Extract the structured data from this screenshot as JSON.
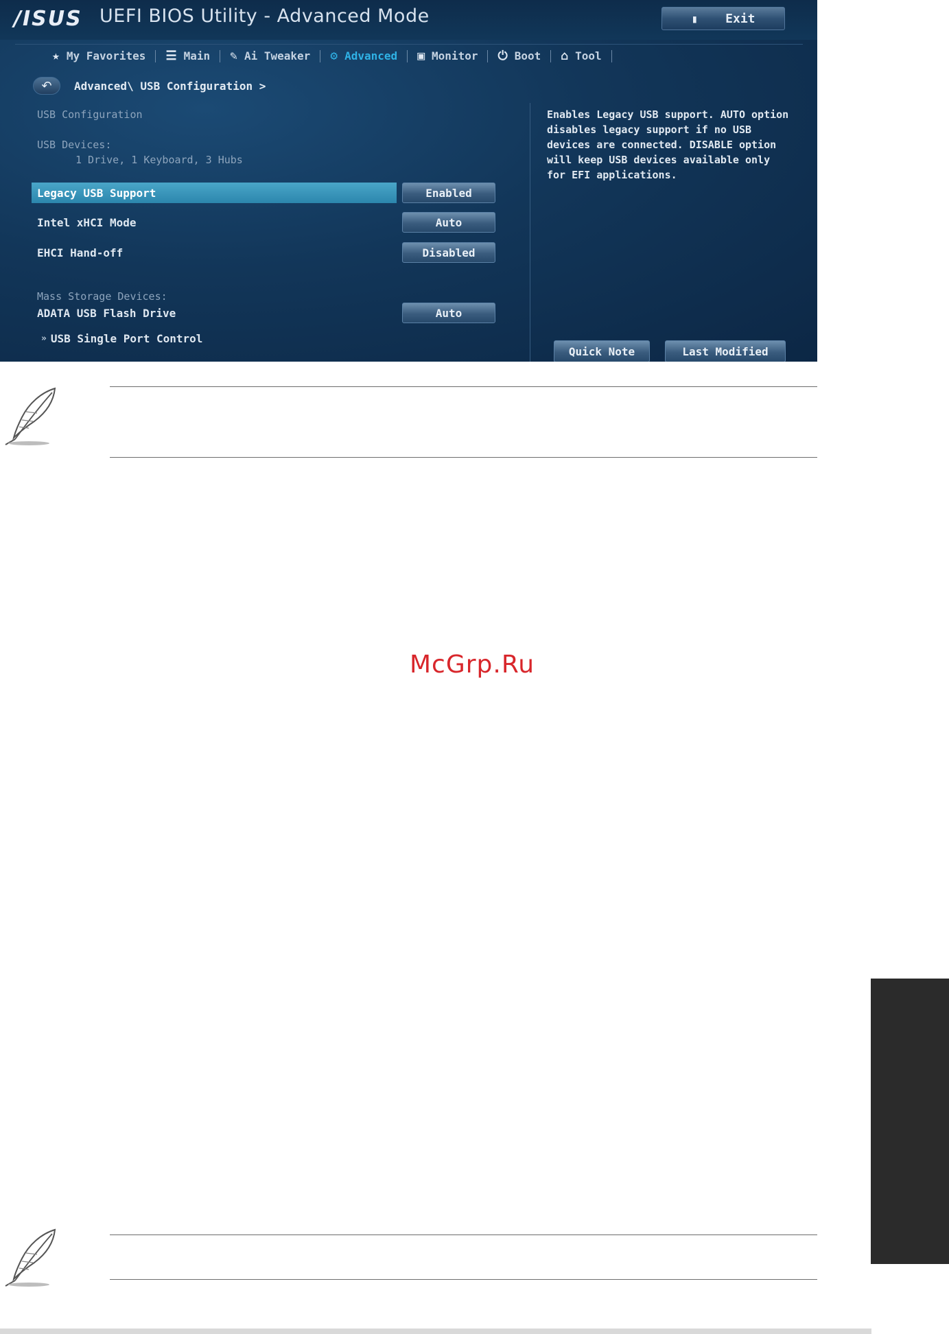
{
  "bios": {
    "logo": "/ISUS",
    "title": "UEFI BIOS Utility - Advanced Mode",
    "exit_label": "Exit",
    "tabs": [
      {
        "label": "My Favorites",
        "icon": "star-icon",
        "glyph": "★"
      },
      {
        "label": "Main",
        "icon": "list-icon",
        "glyph": "☰"
      },
      {
        "label": "Ai Tweaker",
        "icon": "tweaker-icon",
        "glyph": "✎"
      },
      {
        "label": "Advanced",
        "icon": "advanced-icon",
        "glyph": "⚙"
      },
      {
        "label": "Monitor",
        "icon": "monitor-icon",
        "glyph": "▣"
      },
      {
        "label": "Boot",
        "icon": "power-icon",
        "glyph": "⏻"
      },
      {
        "label": "Tool",
        "icon": "tool-icon",
        "glyph": "⌂"
      }
    ],
    "active_tab": "Advanced",
    "breadcrumb": "Advanced\\ USB Configuration >",
    "usb_config_label": "USB Configuration",
    "usb_devices_label": "USB Devices:",
    "usb_devices_value": "1 Drive, 1 Keyboard, 3 Hubs",
    "settings": [
      {
        "label": "Legacy USB Support",
        "value": "Enabled"
      },
      {
        "label": "Intel xHCI Mode",
        "value": "Auto"
      },
      {
        "label": "EHCI Hand-off",
        "value": "Disabled"
      }
    ],
    "mass_storage_label": "Mass Storage Devices:",
    "mass_storage_device": {
      "label": "ADATA USB Flash Drive",
      "value": "Auto"
    },
    "submenu": "USB Single Port Control",
    "help_text": "Enables Legacy USB support. AUTO option disables legacy support if no USB devices are connected. DISABLE option will keep USB devices available only for EFI applications.",
    "quick_note": "Quick Note",
    "last_modified": "Last Modified"
  },
  "watermark": "McGrp.Ru",
  "colors": {
    "bios_bg": "#123659",
    "highlight": "#2c86ad",
    "active_tab": "#2fb2e6",
    "watermark": "#d8262b",
    "side_tab": "#2b2b2b"
  }
}
